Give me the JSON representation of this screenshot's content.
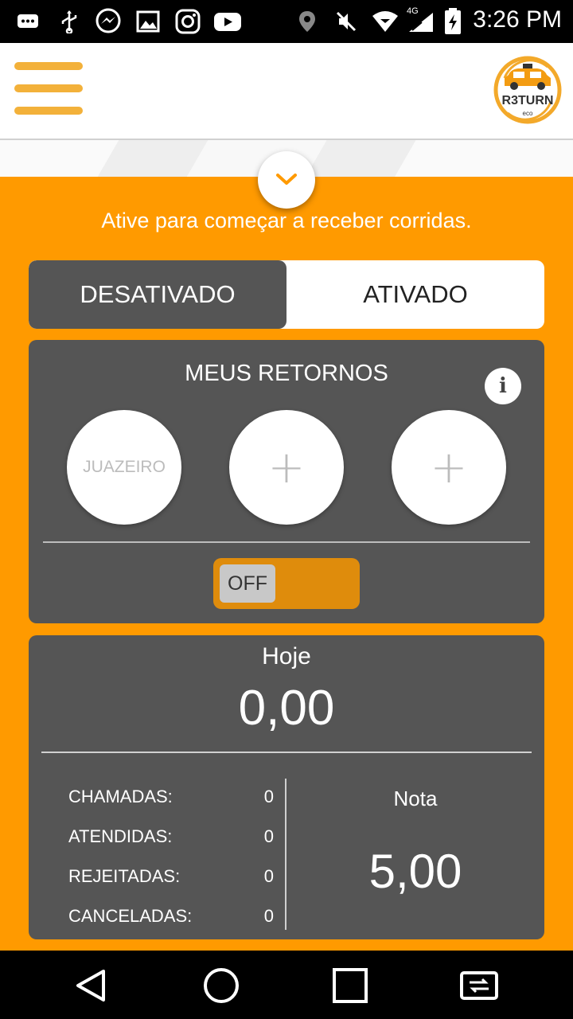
{
  "status_bar": {
    "time": "3:26 PM",
    "network": "4G",
    "icons": [
      "chat-bubble-icon",
      "usb-icon",
      "messenger-icon",
      "gallery-icon",
      "instagram-icon",
      "youtube-icon",
      "location-icon",
      "mute-icon",
      "wifi-icon",
      "signal-icon",
      "battery-charging-icon"
    ]
  },
  "header": {
    "menu_icon": "hamburger-menu-icon",
    "logo_text": "R3TURN",
    "logo_sub": "eco"
  },
  "panel": {
    "hint": "Ative para começar a receber corridas.",
    "collapse_icon": "chevron-down-icon",
    "colors": {
      "accent": "#ff9a00",
      "card": "#555555",
      "switch": "#df8c0c"
    }
  },
  "status_toggle": {
    "off_label": "DESATIVADO",
    "on_label": "ATIVADO",
    "selected": "DESATIVADO"
  },
  "returns": {
    "title": "MEUS RETORNOS",
    "info_label": "i",
    "slots": [
      {
        "label": "JUAZEIRO"
      },
      {
        "label": "+"
      },
      {
        "label": "+"
      }
    ],
    "switch_label": "OFF"
  },
  "stats": {
    "today_label": "Hoje",
    "today_value": "0,00",
    "rows": [
      {
        "label": "CHAMADAS:",
        "value": "0"
      },
      {
        "label": "ATENDIDAS:",
        "value": "0"
      },
      {
        "label": "REJEITADAS:",
        "value": "0"
      },
      {
        "label": "CANCELADAS:",
        "value": "0"
      }
    ],
    "rating_label": "Nota",
    "rating_value": "5,00"
  },
  "nav": {
    "buttons": [
      "back-icon",
      "home-icon",
      "recents-icon",
      "screen-switch-icon"
    ]
  }
}
